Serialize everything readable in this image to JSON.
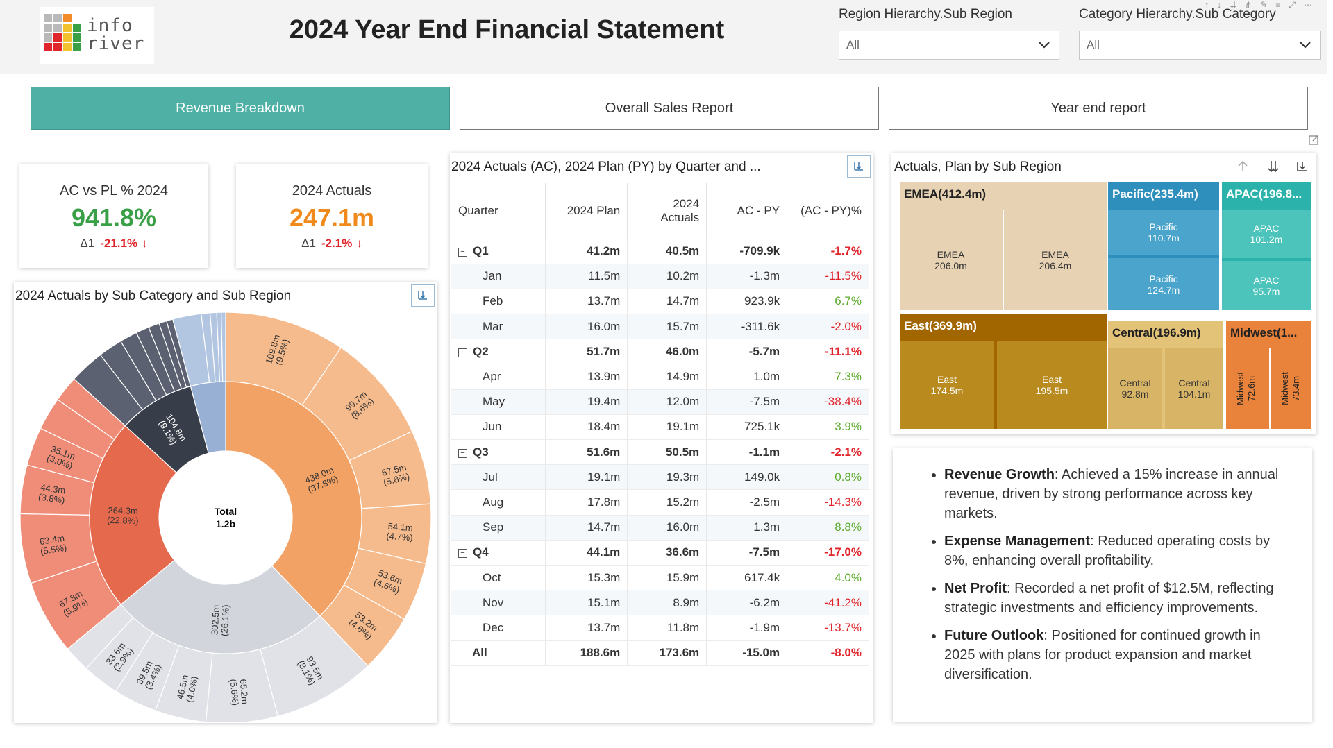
{
  "header": {
    "logo_line1": "info",
    "logo_line2": "river",
    "title": "2024 Year End Financial Statement",
    "filters": [
      {
        "label": "Region Hierarchy.Sub Region",
        "value": "All"
      },
      {
        "label": "Category Hierarchy.Sub Category",
        "value": "All"
      }
    ]
  },
  "nav": {
    "tabs": [
      {
        "label": "Revenue Breakdown",
        "active": true
      },
      {
        "label": "Overall Sales Report",
        "active": false
      },
      {
        "label": "Year end report",
        "active": false
      }
    ]
  },
  "kpis": [
    {
      "title": "AC vs PL % 2024",
      "value": "941.8%",
      "value_color": "#3aa047",
      "delta_label": "Δ1",
      "delta": "-21.1%",
      "arrow": "↓"
    },
    {
      "title": "2024 Actuals",
      "value": "247.1m",
      "value_color": "#f08a1c",
      "delta_label": "Δ1",
      "delta": "-2.1%",
      "arrow": "↓"
    }
  ],
  "sunburst": {
    "title": "2024 Actuals by Sub Category and Sub Region",
    "center_label": "Total",
    "center_value": "1.2b"
  },
  "chart_data": {
    "type": "sunburst",
    "title": "2024 Actuals by Sub Category and Sub Region",
    "total": "1.2b",
    "inner": [
      {
        "label": "438.0m",
        "pct": "(37.8%)",
        "value": 438.0,
        "color": "#f3a266"
      },
      {
        "label": "302.5m",
        "pct": "(26.1%)",
        "value": 302.5,
        "color": "#d2d5dc"
      },
      {
        "label": "264.3m",
        "pct": "(22.8%)",
        "value": 264.3,
        "color": "#e5694d"
      },
      {
        "label": "104.8m",
        "pct": "(9.1%)",
        "value": 104.8,
        "color": "#373d49"
      },
      {
        "label": "",
        "pct": "",
        "value": 48.0,
        "color": "#97b0d4"
      }
    ],
    "outer": [
      {
        "label": "109.8m",
        "pct": "(9.5%)",
        "value": 109.8,
        "color": "#f6bb8d"
      },
      {
        "label": "99.7m",
        "pct": "(8.6%)",
        "value": 99.7,
        "color": "#f6bb8d"
      },
      {
        "label": "67.5m",
        "pct": "(5.8%)",
        "value": 67.5,
        "color": "#f6bb8d"
      },
      {
        "label": "54.1m",
        "pct": "(4.7%)",
        "value": 54.1,
        "color": "#f6bb8d"
      },
      {
        "label": "53.6m",
        "pct": "(4.6%)",
        "value": 53.6,
        "color": "#f6bb8d"
      },
      {
        "label": "53.2m",
        "pct": "(4.6%)",
        "value": 53.2,
        "color": "#f6bb8d"
      },
      {
        "label": "93.5m",
        "pct": "(8.1%)",
        "value": 93.5,
        "color": "#e0e2e7"
      },
      {
        "label": "65.2m",
        "pct": "(5.6%)",
        "value": 65.2,
        "color": "#e0e2e7"
      },
      {
        "label": "46.5m",
        "pct": "(4.0%)",
        "value": 46.5,
        "color": "#e0e2e7"
      },
      {
        "label": "39.5m",
        "pct": "(3.4%)",
        "value": 39.5,
        "color": "#e0e2e7"
      },
      {
        "label": "33.6m",
        "pct": "(2.9%)",
        "value": 33.6,
        "color": "#e0e2e7"
      },
      {
        "label": "",
        "pct": "",
        "value": 24.2,
        "color": "#e0e2e7"
      },
      {
        "label": "67.8m",
        "pct": "(5.9%)",
        "value": 67.8,
        "color": "#ef8d78"
      },
      {
        "label": "63.4m",
        "pct": "(5.5%)",
        "value": 63.4,
        "color": "#ef8d78"
      },
      {
        "label": "44.3m",
        "pct": "(3.8%)",
        "value": 44.3,
        "color": "#ef8d78"
      },
      {
        "label": "35.1m",
        "pct": "(3.0%)",
        "value": 35.1,
        "color": "#ef8d78"
      },
      {
        "label": "",
        "pct": "",
        "value": 30.0,
        "color": "#ef8d78"
      },
      {
        "label": "",
        "pct": "",
        "value": 23.7,
        "color": "#ef8d78"
      },
      {
        "label": "",
        "pct": "",
        "value": 32.0,
        "color": "#5b6170"
      },
      {
        "label": "",
        "pct": "",
        "value": 22.0,
        "color": "#5b6170"
      },
      {
        "label": "",
        "pct": "",
        "value": 16.0,
        "color": "#5b6170"
      },
      {
        "label": "",
        "pct": "",
        "value": 12.0,
        "color": "#5b6170"
      },
      {
        "label": "",
        "pct": "",
        "value": 10.0,
        "color": "#5b6170"
      },
      {
        "label": "",
        "pct": "",
        "value": 7.0,
        "color": "#5b6170"
      },
      {
        "label": "",
        "pct": "",
        "value": 5.8,
        "color": "#5b6170"
      },
      {
        "label": "",
        "pct": "",
        "value": 26.0,
        "color": "#b2c5e1"
      },
      {
        "label": "",
        "pct": "",
        "value": 8.0,
        "color": "#b2c5e1"
      },
      {
        "label": "",
        "pct": "",
        "value": 6.0,
        "color": "#b2c5e1"
      },
      {
        "label": "",
        "pct": "",
        "value": 4.0,
        "color": "#b2c5e1"
      },
      {
        "label": "",
        "pct": "",
        "value": 4.0,
        "color": "#b2c5e1"
      }
    ]
  },
  "matrix": {
    "title": "2024 Actuals (AC), 2024 Plan (PY) by Quarter and ...",
    "columns": [
      "Quarter",
      "2024 Plan",
      "2024 Actuals",
      "AC - PY",
      "(AC - PY)%"
    ],
    "rows": [
      {
        "level": "quarter",
        "label": "Q1",
        "plan": "41.2m",
        "actual": "40.5m",
        "diff": "-709.9k",
        "pct": "-1.7%",
        "sign": "neg"
      },
      {
        "level": "month",
        "label": "Jan",
        "plan": "11.5m",
        "actual": "10.2m",
        "diff": "-1.3m",
        "pct": "-11.5%",
        "sign": "neg"
      },
      {
        "level": "month",
        "label": "Feb",
        "plan": "13.7m",
        "actual": "14.7m",
        "diff": "923.9k",
        "pct": "6.7%",
        "sign": "pos"
      },
      {
        "level": "month",
        "label": "Mar",
        "plan": "16.0m",
        "actual": "15.7m",
        "diff": "-311.6k",
        "pct": "-2.0%",
        "sign": "neg"
      },
      {
        "level": "quarter",
        "label": "Q2",
        "plan": "51.7m",
        "actual": "46.0m",
        "diff": "-5.7m",
        "pct": "-11.1%",
        "sign": "neg"
      },
      {
        "level": "month",
        "label": "Apr",
        "plan": "13.9m",
        "actual": "14.9m",
        "diff": "1.0m",
        "pct": "7.3%",
        "sign": "pos"
      },
      {
        "level": "month",
        "label": "May",
        "plan": "19.4m",
        "actual": "12.0m",
        "diff": "-7.5m",
        "pct": "-38.4%",
        "sign": "neg"
      },
      {
        "level": "month",
        "label": "Jun",
        "plan": "18.4m",
        "actual": "19.1m",
        "diff": "725.1k",
        "pct": "3.9%",
        "sign": "pos"
      },
      {
        "level": "quarter",
        "label": "Q3",
        "plan": "51.6m",
        "actual": "50.5m",
        "diff": "-1.1m",
        "pct": "-2.1%",
        "sign": "neg"
      },
      {
        "level": "month",
        "label": "Jul",
        "plan": "19.1m",
        "actual": "19.3m",
        "diff": "149.0k",
        "pct": "0.8%",
        "sign": "pos"
      },
      {
        "level": "month",
        "label": "Aug",
        "plan": "17.8m",
        "actual": "15.2m",
        "diff": "-2.5m",
        "pct": "-14.3%",
        "sign": "neg"
      },
      {
        "level": "month",
        "label": "Sep",
        "plan": "14.7m",
        "actual": "16.0m",
        "diff": "1.3m",
        "pct": "8.8%",
        "sign": "pos"
      },
      {
        "level": "quarter",
        "label": "Q4",
        "plan": "44.1m",
        "actual": "36.6m",
        "diff": "-7.5m",
        "pct": "-17.0%",
        "sign": "neg"
      },
      {
        "level": "month",
        "label": "Oct",
        "plan": "15.3m",
        "actual": "15.9m",
        "diff": "617.4k",
        "pct": "4.0%",
        "sign": "pos"
      },
      {
        "level": "month",
        "label": "Nov",
        "plan": "15.1m",
        "actual": "8.9m",
        "diff": "-6.2m",
        "pct": "-41.2%",
        "sign": "neg"
      },
      {
        "level": "month",
        "label": "Dec",
        "plan": "13.7m",
        "actual": "11.8m",
        "diff": "-1.9m",
        "pct": "-13.7%",
        "sign": "neg"
      },
      {
        "level": "total",
        "label": "All",
        "plan": "188.6m",
        "actual": "173.6m",
        "diff": "-15.0m",
        "pct": "-8.0%",
        "sign": "neg"
      }
    ]
  },
  "treemap": {
    "title": "Actuals, Plan by Sub Region",
    "groups": [
      {
        "name": "EMEA(412.4m)",
        "leaves": [
          {
            "name": "EMEA",
            "value": "206.0m"
          },
          {
            "name": "EMEA",
            "value": "206.4m"
          }
        ]
      },
      {
        "name": "Pacific(235.4m)",
        "leaves": [
          {
            "name": "Pacific",
            "value": "110.7m"
          },
          {
            "name": "Pacific",
            "value": "124.7m"
          }
        ]
      },
      {
        "name": "APAC(196.8...",
        "leaves": [
          {
            "name": "APAC",
            "value": "101.2m"
          },
          {
            "name": "APAC",
            "value": "95.7m"
          }
        ]
      },
      {
        "name": "East(369.9m)",
        "leaves": [
          {
            "name": "East",
            "value": "174.5m"
          },
          {
            "name": "East",
            "value": "195.5m"
          }
        ]
      },
      {
        "name": "Central(196.9m)",
        "leaves": [
          {
            "name": "Central",
            "value": "92.8m"
          },
          {
            "name": "Central",
            "value": "104.1m"
          }
        ]
      },
      {
        "name": "Midwest(1...",
        "leaves": [
          {
            "name": "Midwest",
            "value": "72.6m"
          },
          {
            "name": "Midwest",
            "value": "73.4m"
          }
        ]
      }
    ]
  },
  "notes": [
    {
      "head": "Revenue Growth",
      "text": ": Achieved a 15% increase in annual revenue, driven by strong performance across key markets."
    },
    {
      "head": "Expense Management",
      "text": ": Reduced operating costs by 8%, enhancing overall profitability."
    },
    {
      "head": "Net Profit",
      "text": ": Recorded a net profit of $12.5M, reflecting strategic investments and efficiency improvements."
    },
    {
      "head": "Future Outlook",
      "text": ": Positioned for continued growth in 2025 with plans for product expansion and market diversification."
    }
  ]
}
